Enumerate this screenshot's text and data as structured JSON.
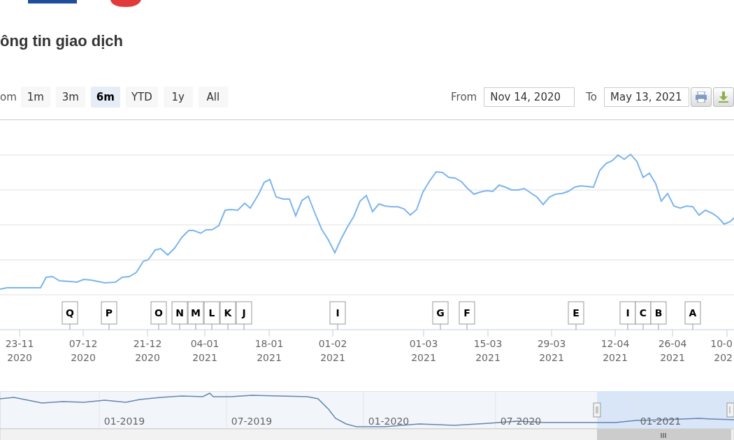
{
  "section_title": "ông tin giao dịch",
  "zoom": {
    "label": "om",
    "buttons": [
      {
        "label": "1m",
        "selected": false
      },
      {
        "label": "3m",
        "selected": false
      },
      {
        "label": "6m",
        "selected": true
      },
      {
        "label": "YTD",
        "selected": false
      },
      {
        "label": "1y",
        "selected": false
      },
      {
        "label": "All",
        "selected": false
      }
    ]
  },
  "range": {
    "from_label": "From",
    "from_value": "Nov 14, 2020",
    "to_label": "To",
    "to_value": "May 13, 2021"
  },
  "flags": [
    {
      "label": "Q"
    },
    {
      "label": "P"
    },
    {
      "label": "O"
    },
    {
      "label": "N"
    },
    {
      "label": "M"
    },
    {
      "label": "L"
    },
    {
      "label": "K"
    },
    {
      "label": "J"
    },
    {
      "label": "I"
    },
    {
      "label": "G"
    },
    {
      "label": "F"
    },
    {
      "label": "E"
    },
    {
      "label": "I"
    },
    {
      "label": "C"
    },
    {
      "label": "B"
    },
    {
      "label": "A"
    }
  ],
  "x_axis_labels": [
    {
      "day": "23-11",
      "year": "2020"
    },
    {
      "day": "07-12",
      "year": "2020"
    },
    {
      "day": "21-12",
      "year": "2020"
    },
    {
      "day": "04-01",
      "year": "2021"
    },
    {
      "day": "18-01",
      "year": "2021"
    },
    {
      "day": "01-02",
      "year": "2021"
    },
    {
      "day": "01-03",
      "year": "2021"
    },
    {
      "day": "15-03",
      "year": "2021"
    },
    {
      "day": "29-03",
      "year": "2021"
    },
    {
      "day": "12-04",
      "year": "2021"
    },
    {
      "day": "26-04",
      "year": "2021"
    },
    {
      "day": "10-0",
      "year": "202"
    }
  ],
  "navigator_labels": [
    "01-2019",
    "07-2019",
    "01-2020",
    "07-2020",
    "01-2021"
  ]
}
